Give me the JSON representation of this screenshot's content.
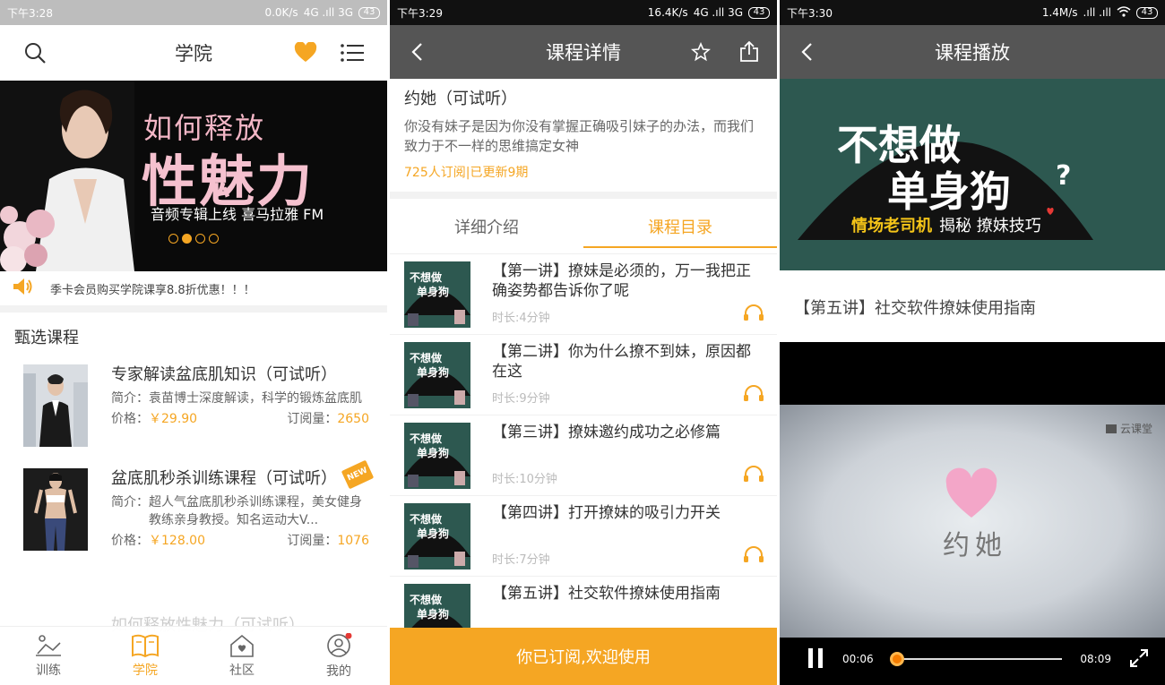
{
  "screen1": {
    "status": {
      "time": "下午3:28",
      "net": "0.0K/s",
      "signal": "4G .ıll 3G",
      "battery": "43"
    },
    "title": "学院",
    "banner": {
      "line1": "如何释放",
      "line2": "性魅力",
      "line3": "音频专辑上线 喜马拉雅 FM",
      "slides_total": 4,
      "slide_active": 2
    },
    "notice": "季卡会员购买学院课享8.8折优惠！！！",
    "section": "甄选课程",
    "courses": [
      {
        "name": "专家解读盆底肌知识（可试听）",
        "intro_label": "简介：",
        "intro": "袁苗博士深度解读，科学的锻炼盆底肌",
        "price_label": "价格：",
        "price": "￥29.90",
        "subs_label": "订阅量：",
        "subs": "2650",
        "badge": ""
      },
      {
        "name": "盆底肌秒杀训练课程（可试听）",
        "intro_label": "简介：",
        "intro": "超人气盆底肌秒杀训练课程，美女健身教练亲身教授。知名运动大V...",
        "price_label": "价格：",
        "price": "￥128.00",
        "subs_label": "订阅量：",
        "subs": "1076",
        "badge": "NEW"
      }
    ],
    "faded_course": "如何释放性魅力（可试听）",
    "tabs": [
      "训练",
      "学院",
      "社区",
      "我的"
    ],
    "active_tab": 1
  },
  "screen2": {
    "status": {
      "time": "下午3:29",
      "net": "16.4K/s",
      "signal": "4G .ıll 3G",
      "battery": "43"
    },
    "title": "课程详情",
    "course_name": "约她（可试听）",
    "desc": "你没有妹子是因为你没有掌握正确吸引妹子的办法，而我们致力于不一样的思维搞定女神",
    "meta": "725人订阅|已更新9期",
    "tabs": [
      "详细介绍",
      "课程目录"
    ],
    "active_tab": 1,
    "thumb_text": [
      "不想做",
      "单身狗"
    ],
    "lessons": [
      {
        "title": "【第一讲】撩妹是必须的，万一我把正确姿势都告诉你了呢",
        "duration": "时长:4分钟"
      },
      {
        "title": "【第二讲】你为什么撩不到妹，原因都在这",
        "duration": "时长:9分钟"
      },
      {
        "title": "【第三讲】撩妹邀约成功之必修篇",
        "duration": "时长:10分钟"
      },
      {
        "title": "【第四讲】打开撩妹的吸引力开关",
        "duration": "时长:7分钟"
      },
      {
        "title": "【第五讲】社交软件撩妹使用指南",
        "duration": ""
      }
    ],
    "subscribe": "你已订阅,欢迎使用"
  },
  "screen3": {
    "status": {
      "time": "下午3:30",
      "net": "1.4M/s",
      "signal": ".ıll .ıll",
      "battery": "43"
    },
    "title": "课程播放",
    "cover": {
      "line1": "不想做",
      "line2": "单身狗",
      "sub_a": "情场老司机",
      "sub_b": "揭秘 撩妹技巧"
    },
    "lesson_title": "【第五讲】社交软件撩妹使用指南",
    "video": {
      "brand": "云课堂",
      "heart_text": "约她",
      "current": "00:06",
      "total": "08:09",
      "progress": 0.01
    }
  },
  "colors": {
    "accent": "#f5a623",
    "dark_bar": "#555555",
    "cover_green": "#2d5850"
  }
}
